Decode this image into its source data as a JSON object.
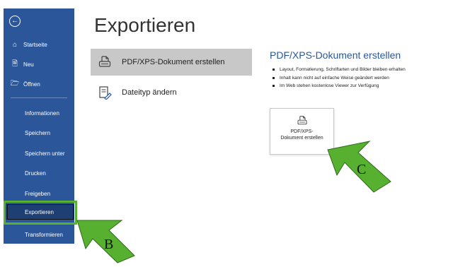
{
  "sidebar": {
    "back_icon": "arrow-left-circle-icon",
    "items": [
      {
        "label": "Startseite",
        "icon": "home-icon"
      },
      {
        "label": "Neu",
        "icon": "new-document-icon"
      },
      {
        "label": "Öffnen",
        "icon": "folder-open-icon"
      },
      {
        "label": "Informationen"
      },
      {
        "label": "Speichern"
      },
      {
        "label": "Speichern unter"
      },
      {
        "label": "Drucken"
      },
      {
        "label": "Freigeben"
      },
      {
        "label": "Exportieren"
      },
      {
        "label": "Transformieren"
      }
    ],
    "colors": {
      "background": "#2b579a",
      "active": "#1d3f74"
    }
  },
  "main": {
    "title": "Exportieren",
    "options": [
      {
        "label": "PDF/XPS-Dokument erstellen",
        "icon": "pdf-document-icon",
        "selected": true
      },
      {
        "label": "Dateityp ändern",
        "icon": "change-file-type-icon",
        "selected": false
      }
    ]
  },
  "details": {
    "title": "PDF/XPS-Dokument erstellen",
    "bullets": [
      "Layout, Formatierung, Schriftarten und Bilder bleiben erhalten",
      "Inhalt kann nicht auf einfache Weise geändert werden",
      "Im Web stehen kostenlose Viewer zur Verfügung"
    ],
    "button": {
      "line1": "PDF/XPS-",
      "line2": "Dokument erstellen",
      "icon": "pdf-document-icon"
    }
  },
  "annotations": {
    "arrow_b_label": "B",
    "arrow_c_label": "C",
    "highlight_color": "#58b030",
    "arrow_color": "#58b030"
  }
}
